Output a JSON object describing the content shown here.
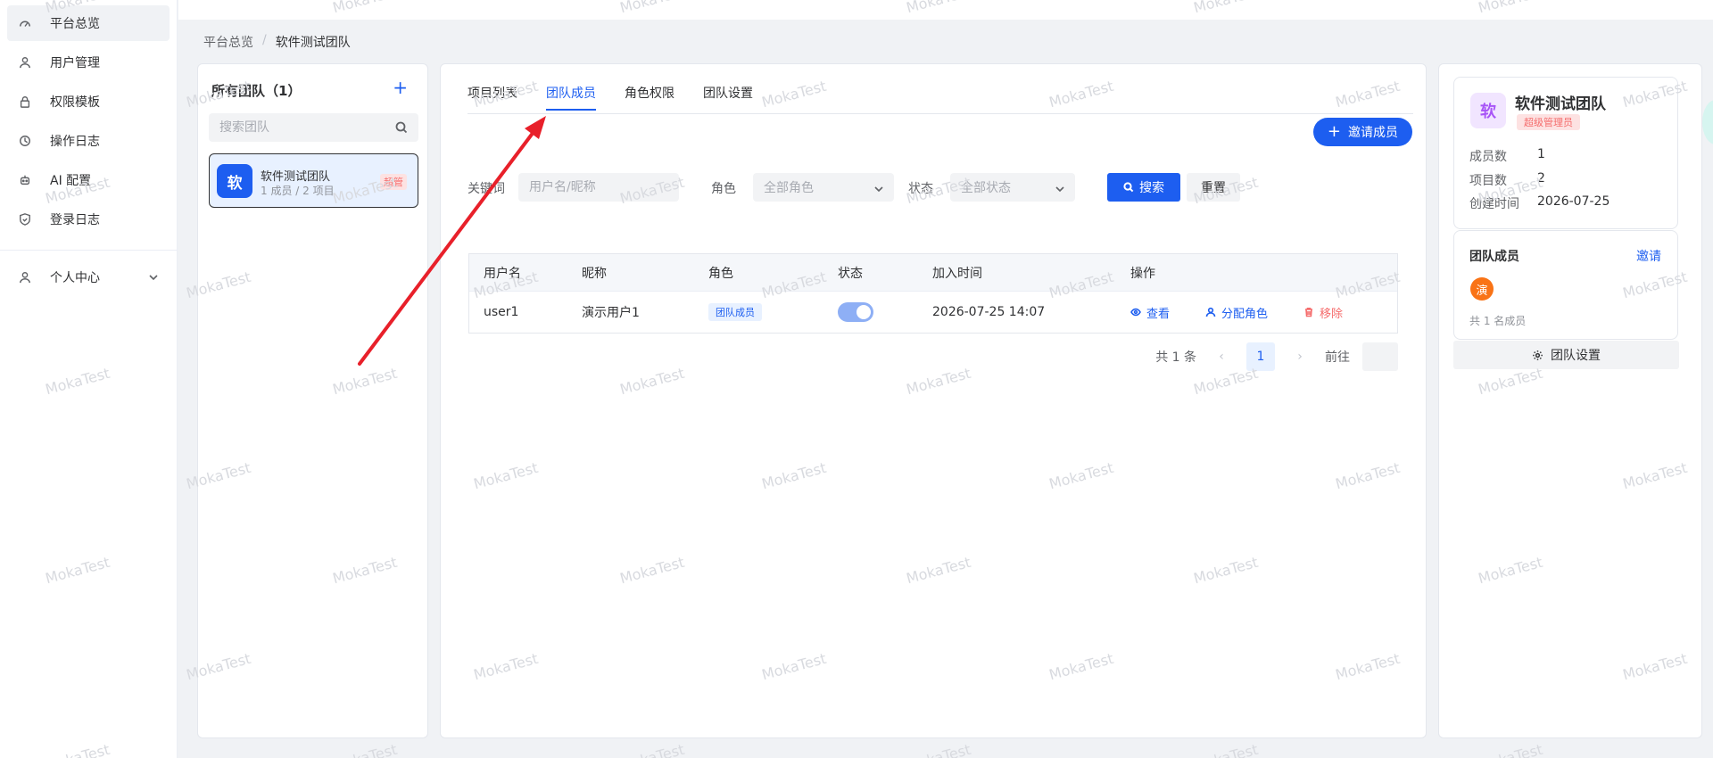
{
  "sidebar": {
    "items": [
      {
        "label": "平台总览",
        "icon": "dashboard-icon"
      },
      {
        "label": "用户管理",
        "icon": "user-icon"
      },
      {
        "label": "权限模板",
        "icon": "lock-icon"
      },
      {
        "label": "操作日志",
        "icon": "history-icon"
      },
      {
        "label": "AI 配置",
        "icon": "robot-icon"
      },
      {
        "label": "登录日志",
        "icon": "shield-icon"
      }
    ],
    "profile": {
      "label": "个人中心",
      "icon": "user-icon"
    }
  },
  "breadcrumb": [
    "平台总览",
    "软件测试团队"
  ],
  "breadcrumb_sep": "/",
  "team_panel": {
    "title": "所有团队（1）",
    "add_symbol": "+",
    "search_placeholder": "搜索团队",
    "teams": [
      {
        "avatar": "软",
        "name": "软件测试团队",
        "meta": "1 成员 / 2 项目",
        "tag": "超管"
      }
    ]
  },
  "main": {
    "tabs": [
      "项目列表",
      "团队成员",
      "角色权限",
      "团队设置"
    ],
    "active_tab": 1,
    "invite_label": "邀请成员",
    "filters": {
      "keyword_label": "关键词",
      "keyword_placeholder": "用户名/昵称",
      "role_label": "角色",
      "role_value": "全部角色",
      "status_label": "状态",
      "status_value": "全部状态",
      "search_label": "搜索",
      "reset_label": "重置"
    },
    "table": {
      "columns": [
        "用户名",
        "昵称",
        "角色",
        "状态",
        "加入时间",
        "操作"
      ],
      "rows": [
        {
          "username": "user1",
          "nickname": "演示用户1",
          "role": "团队成员",
          "status_on": true,
          "joined": "2026-07-25 14:07",
          "ops": {
            "view": "查看",
            "assign": "分配角色",
            "remove": "移除"
          }
        }
      ]
    },
    "pagination": {
      "total": "共 1 条",
      "prev": "‹",
      "page": "1",
      "next": "›",
      "goto_label": "前往"
    }
  },
  "team_info": {
    "avatar": "软",
    "name": "软件测试团队",
    "tag": "超级管理员",
    "stats": [
      {
        "label": "成员数",
        "value": "1"
      },
      {
        "label": "项目数",
        "value": "2"
      },
      {
        "label": "创建时间",
        "value": "2026-07-25"
      }
    ],
    "members_title": "团队成员",
    "invite_link": "邀请",
    "member_avatar": "演",
    "member_count": "共 1 名成员",
    "settings_label": "团队设置"
  },
  "watermark": "MokaTest",
  "colors": {
    "primary": "#1d5ef0",
    "danger": "#f56c6c",
    "annotation_arrow": "#e8202a"
  }
}
